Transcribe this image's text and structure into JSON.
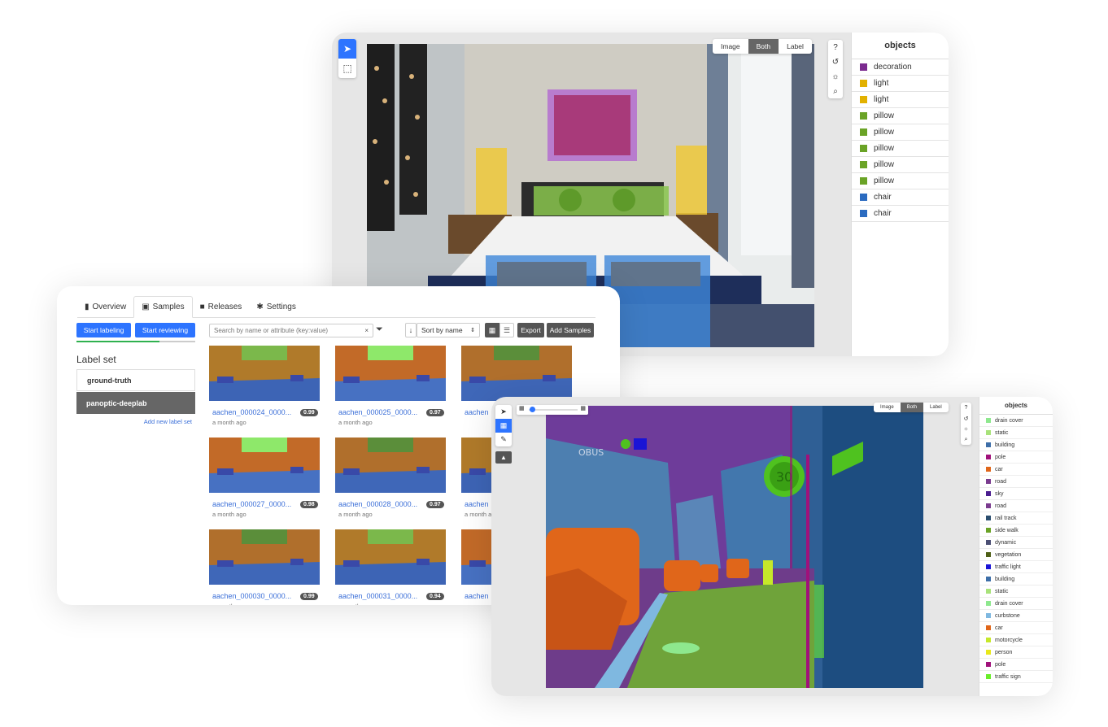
{
  "top_panel": {
    "view_toggle": [
      "Image",
      "Both",
      "Label"
    ],
    "view_active": "Both",
    "sidebar_title": "objects",
    "objects": [
      {
        "label": "decoration",
        "color": "#7b2b8f"
      },
      {
        "label": "light",
        "color": "#e2b100"
      },
      {
        "label": "light",
        "color": "#e2b100"
      },
      {
        "label": "pillow",
        "color": "#6aa326"
      },
      {
        "label": "pillow",
        "color": "#6aa326"
      },
      {
        "label": "pillow",
        "color": "#6aa326"
      },
      {
        "label": "pillow",
        "color": "#6aa326"
      },
      {
        "label": "pillow",
        "color": "#6aa326"
      },
      {
        "label": "chair",
        "color": "#2b6bc0"
      },
      {
        "label": "chair",
        "color": "#2b6bc0"
      }
    ]
  },
  "dataset_panel": {
    "tabs": [
      {
        "label": "Overview",
        "icon": "bookmark-icon"
      },
      {
        "label": "Samples",
        "icon": "images-icon"
      },
      {
        "label": "Releases",
        "icon": "gift-icon"
      },
      {
        "label": "Settings",
        "icon": "gear-icon"
      }
    ],
    "active_tab": "Samples",
    "start_labeling": "Start labeling",
    "start_reviewing": "Start reviewing",
    "label_set_title": "Label set",
    "label_sets": [
      "ground-truth",
      "panoptic-deeplab"
    ],
    "active_label_set": "panoptic-deeplab",
    "add_label_set": "Add new label set",
    "search_placeholder": "Search by name or attribute (key:value)",
    "search_clear": "×",
    "sort_label": "Sort by name",
    "export": "Export",
    "add_samples": "Add Samples",
    "samples": [
      {
        "name": "aachen_000024_0000...",
        "score": "0.99",
        "ago": "a month ago"
      },
      {
        "name": "aachen_000025_0000...",
        "score": "0.97",
        "ago": "a month ago"
      },
      {
        "name": "aachen",
        "score": "",
        "ago": ""
      },
      {
        "name": "aachen_000027_0000...",
        "score": "0.98",
        "ago": "a month ago"
      },
      {
        "name": "aachen_000028_0000...",
        "score": "0.97",
        "ago": "a month ago"
      },
      {
        "name": "aachen",
        "score": "",
        "ago": "a month a"
      },
      {
        "name": "aachen_000030_0000...",
        "score": "0.99",
        "ago": "a month ago"
      },
      {
        "name": "aachen_000031_0000...",
        "score": "0.94",
        "ago": "a month ago"
      },
      {
        "name": "aachen",
        "score": "",
        "ago": ""
      }
    ]
  },
  "segmentation_panel": {
    "view_toggle": [
      "Image",
      "Both",
      "Label"
    ],
    "view_active": "Both",
    "sidebar_title": "objects",
    "sign_text": "30",
    "storefront_text": "OBUS",
    "objects": [
      {
        "label": "drain cover",
        "color": "#8ee88e"
      },
      {
        "label": "static",
        "color": "#a8e27a"
      },
      {
        "label": "building",
        "color": "#3d6ea8"
      },
      {
        "label": "pole",
        "color": "#a0117a"
      },
      {
        "label": "car",
        "color": "#e0661a"
      },
      {
        "label": "road",
        "color": "#7a3b8f"
      },
      {
        "label": "sky",
        "color": "#4a1d8f"
      },
      {
        "label": "road",
        "color": "#7a3b8f"
      },
      {
        "label": "rail track",
        "color": "#2a4d6e"
      },
      {
        "label": "side walk",
        "color": "#6aa326"
      },
      {
        "label": "dynamic",
        "color": "#4b4f74"
      },
      {
        "label": "vegetation",
        "color": "#4e5f16"
      },
      {
        "label": "traffic light",
        "color": "#1a14d6"
      },
      {
        "label": "building",
        "color": "#3d6ea8"
      },
      {
        "label": "static",
        "color": "#a8e27a"
      },
      {
        "label": "drain cover",
        "color": "#8ee88e"
      },
      {
        "label": "curbstone",
        "color": "#7fb8e0"
      },
      {
        "label": "car",
        "color": "#e0661a"
      },
      {
        "label": "motorcycle",
        "color": "#c6e82a"
      },
      {
        "label": "person",
        "color": "#e8e81a"
      },
      {
        "label": "pole",
        "color": "#a0117a"
      },
      {
        "label": "traffic sign",
        "color": "#6aee2a"
      }
    ]
  }
}
